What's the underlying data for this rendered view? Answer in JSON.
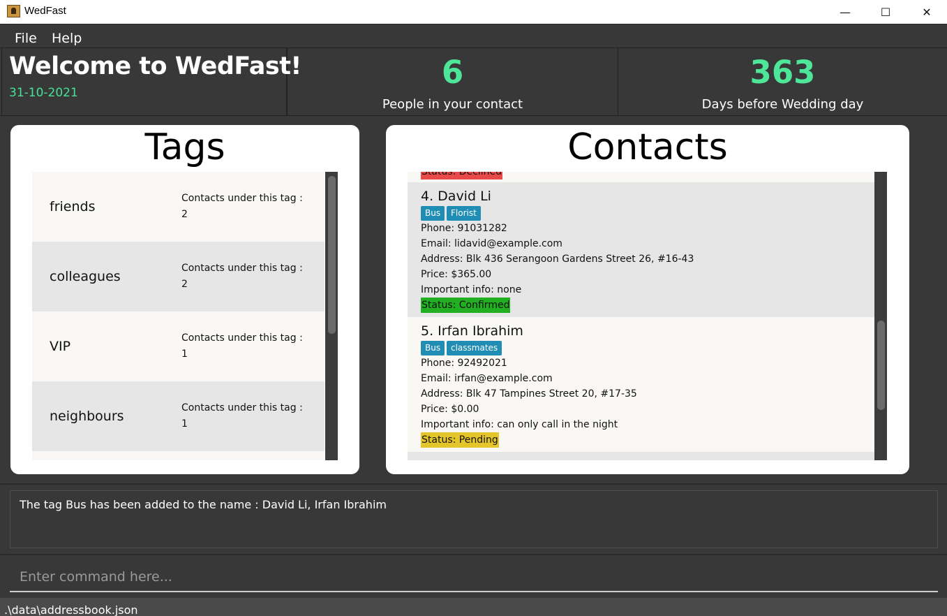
{
  "window": {
    "title": "WedFast",
    "minimize_glyph": "—",
    "maximize_glyph": "☐",
    "close_glyph": "✕"
  },
  "menu": {
    "items": [
      {
        "label": "File"
      },
      {
        "label": "Help"
      }
    ]
  },
  "header": {
    "welcome": "Welcome to WedFast!",
    "date": "31-10-2021",
    "stats": [
      {
        "value": "6",
        "label": "People in your contact"
      },
      {
        "value": "363",
        "label": "Days before Wedding day"
      }
    ]
  },
  "tags_panel": {
    "title": "Tags",
    "items": [
      {
        "name": "friends",
        "count_label": "Contacts under this tag :",
        "count": "2"
      },
      {
        "name": "colleagues",
        "count_label": "Contacts under this tag :",
        "count": "2"
      },
      {
        "name": "VIP",
        "count_label": "Contacts under this tag :",
        "count": "1"
      },
      {
        "name": "neighbours",
        "count_label": "Contacts under this tag :",
        "count": "1"
      }
    ]
  },
  "contacts_panel": {
    "title": "Contacts",
    "partial_status": "Status: Declined",
    "cards": [
      {
        "name": "4.  David Li",
        "tags": [
          "Bus",
          "Florist"
        ],
        "phone": "Phone: 91031282",
        "email": "Email: lidavid@example.com",
        "address": "Address: Blk 436 Serangoon Gardens Street 26, #16-43",
        "price": "Price: $365.00",
        "info": "Important info: none",
        "status": "Status: Confirmed"
      },
      {
        "name": "5.  Irfan Ibrahim",
        "tags": [
          "Bus",
          "classmates"
        ],
        "phone": "Phone: 92492021",
        "email": "Email: irfan@example.com",
        "address": "Address: Blk 47 Tampines Street 20, #17-35",
        "price": "Price: $0.00",
        "info": "Important info: can only call in the night",
        "status": "Status: Pending"
      }
    ]
  },
  "result": {
    "text": "The tag Bus has been added to the name : David Li, Irfan Ibrahim"
  },
  "command": {
    "placeholder": "Enter command here..."
  },
  "statusbar": {
    "path": ".\\data\\addressbook.json"
  },
  "colors": {
    "background": "#383838",
    "accent_green": "#4ee698",
    "tag_chip": "#1f8db4",
    "status_declined": "#e84a4a",
    "status_confirmed": "#22b022",
    "status_pending": "#e4c52a",
    "row_light": "#f9f8f4",
    "row_dark": "#e6e6e6"
  }
}
